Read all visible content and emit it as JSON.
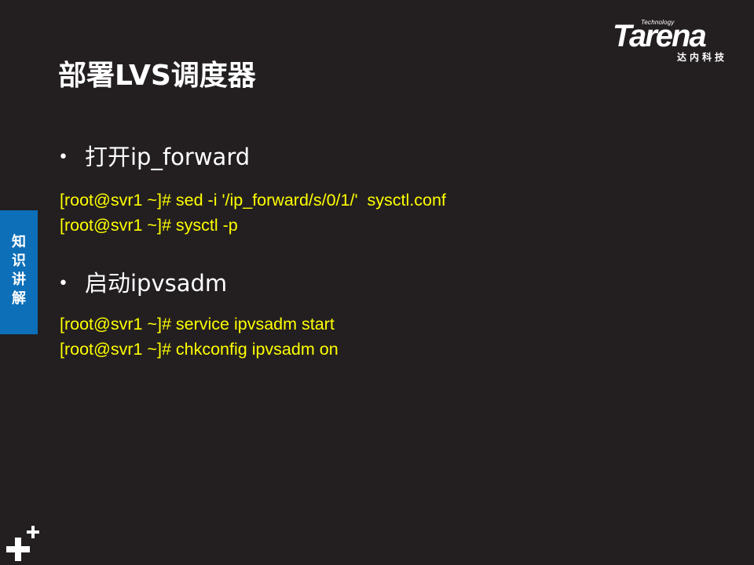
{
  "logo": {
    "tagline": "Technology",
    "wordmark": "Tarena",
    "chinese": "达内科技"
  },
  "title": "部署LVS调度器",
  "side_tab": {
    "chars": [
      "知",
      "识",
      "讲",
      "解"
    ]
  },
  "sections": [
    {
      "bullet": "•",
      "heading": "打开ip_forward",
      "commands": [
        "[root@svr1 ~]# sed -i '/ip_forward/s/0/1/'  sysctl.conf",
        "[root@svr1 ~]# sysctl -p"
      ]
    },
    {
      "bullet": "•",
      "heading": "启动ipvsadm",
      "commands": [
        "[root@svr1 ~]# service ipvsadm start",
        "[root@svr1 ~]# chkconfig ipvsadm on"
      ]
    }
  ],
  "icons": {
    "corner": "plus-icon"
  },
  "colors": {
    "background": "#231f20",
    "title": "#ffffff",
    "code": "#ffff00",
    "side_tab": "#0d6fb8"
  }
}
